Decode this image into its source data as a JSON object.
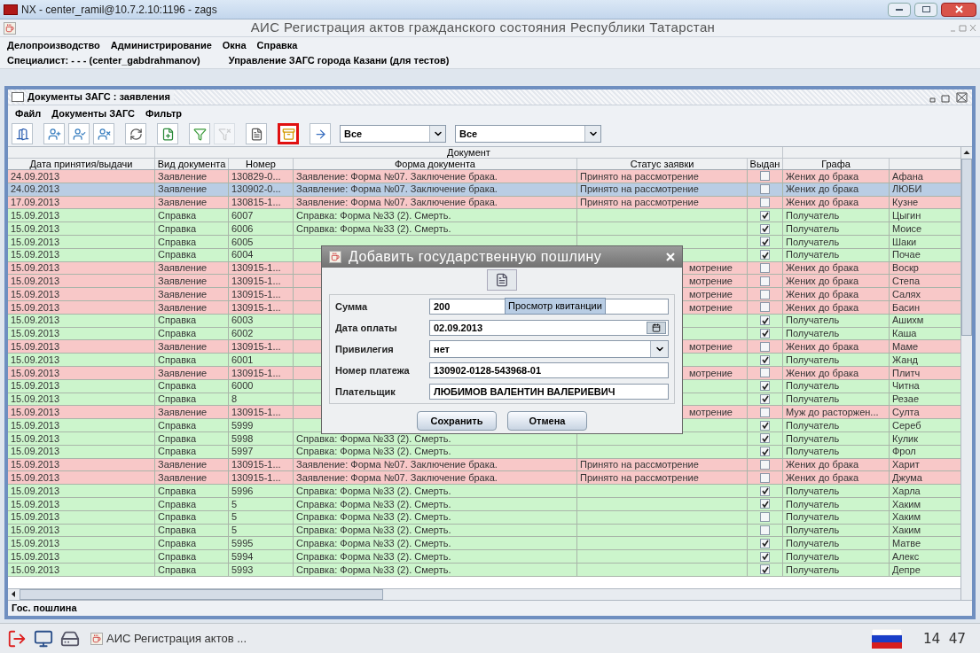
{
  "window": {
    "title": "NX - center_ramil@10.7.2.10:1196 - zags"
  },
  "app": {
    "title": "АИС Регистрация актов гражданского состояния Республики Татарстан",
    "menu": [
      "Делопроизводство",
      "Администрирование",
      "Окна",
      "Справка"
    ],
    "specialist": "Специалист: - - - (center_gabdrahmanov)",
    "office": "Управление ЗАГС города Казани (для тестов)"
  },
  "frame": {
    "title": "Документы ЗАГС : заявления",
    "menu": [
      "Файл",
      "Документы ЗАГС",
      "Фильтр"
    ],
    "toolbar": [
      {
        "kind": "exit",
        "highlighted": false,
        "disabled": false
      },
      {
        "kind": "add",
        "highlighted": false,
        "disabled": false
      },
      {
        "kind": "check",
        "highlighted": false,
        "disabled": false
      },
      {
        "kind": "remove",
        "highlighted": false,
        "disabled": false
      },
      {
        "kind": "refresh",
        "highlighted": false,
        "disabled": false
      },
      {
        "kind": "new",
        "highlighted": false,
        "disabled": false
      },
      {
        "kind": "filter",
        "highlighted": false,
        "disabled": false
      },
      {
        "kind": "unfilter",
        "highlighted": false,
        "disabled": true
      },
      {
        "kind": "document",
        "highlighted": false,
        "disabled": false
      },
      {
        "kind": "fee",
        "highlighted": true,
        "disabled": false
      },
      {
        "kind": "go",
        "highlighted": false,
        "disabled": false
      }
    ],
    "combos": [
      {
        "value": "Все"
      },
      {
        "value": "Все"
      }
    ],
    "group_header": "Документ",
    "columns": [
      "Дата принятия/выдачи",
      "Вид документа",
      "Номер",
      "Форма документа",
      "Статус заявки",
      "Выдан",
      "Графа"
    ],
    "rows": [
      {
        "date": "24.09.2013",
        "kind": "Заявление",
        "number": "130829-0...",
        "form": "Заявление: Форма №07. Заключение брака.",
        "status": "Принято на рассмотрение",
        "issued": false,
        "role": "Жених до брака",
        "name": "Афана",
        "color": "#f8c8c8",
        "selected": false
      },
      {
        "date": "24.09.2013",
        "kind": "Заявление",
        "number": "130902-0...",
        "form": "Заявление: Форма №07. Заключение брака.",
        "status": "Принято на рассмотрение",
        "issued": false,
        "role": "Жених до брака",
        "name": "ЛЮБИ",
        "selected": true
      },
      {
        "date": "17.09.2013",
        "kind": "Заявление",
        "number": "130815-1...",
        "form": "Заявление: Форма №07. Заключение брака.",
        "status": "Принято на рассмотрение",
        "issued": false,
        "role": "Жених до брака",
        "name": "Кузне",
        "color": "#f8c8c8",
        "selected": false
      },
      {
        "date": "15.09.2013",
        "kind": "Справка",
        "number": "6007",
        "form": "Справка: Форма №33 (2). Смерть.",
        "issued": true,
        "role": "Получатель",
        "name": "Цыгин",
        "color": "#ccf5cc",
        "selected": false
      },
      {
        "date": "15.09.2013",
        "kind": "Справка",
        "number": "6006",
        "form": "Справка: Форма №33 (2). Смерть.",
        "issued": true,
        "role": "Получатель",
        "name": "Моисе",
        "color": "#ccf5cc",
        "selected": false
      },
      {
        "date": "15.09.2013",
        "kind": "Справка",
        "number": "6005",
        "issued": true,
        "role": "Получатель",
        "name": "Шаки",
        "color": "#ccf5cc",
        "selected": false
      },
      {
        "date": "15.09.2013",
        "kind": "Справка",
        "number": "6004",
        "issued": true,
        "role": "Получатель",
        "name": "Почае",
        "color": "#ccf5cc",
        "selected": false
      },
      {
        "date": "15.09.2013",
        "kind": "Заявление",
        "number": "130915-1...",
        "status_tail": "мотрение",
        "issued": false,
        "role": "Жених до брака",
        "name": "Воскр",
        "color": "#f8c8c8",
        "selected": false
      },
      {
        "date": "15.09.2013",
        "kind": "Заявление",
        "number": "130915-1...",
        "status_tail": "мотрение",
        "issued": false,
        "role": "Жених до брака",
        "name": "Степа",
        "color": "#f8c8c8",
        "selected": false
      },
      {
        "date": "15.09.2013",
        "kind": "Заявление",
        "number": "130915-1...",
        "status_tail": "мотрение",
        "issued": false,
        "role": "Жених до брака",
        "name": "Салях",
        "color": "#f8c8c8",
        "selected": false
      },
      {
        "date": "15.09.2013",
        "kind": "Заявление",
        "number": "130915-1...",
        "status_tail": "мотрение",
        "issued": false,
        "role": "Жених до брака",
        "name": "Басин",
        "color": "#f8c8c8",
        "selected": false
      },
      {
        "date": "15.09.2013",
        "kind": "Справка",
        "number": "6003",
        "issued": true,
        "role": "Получатель",
        "name": "Ашихм",
        "color": "#ccf5cc",
        "selected": false
      },
      {
        "date": "15.09.2013",
        "kind": "Справка",
        "number": "6002",
        "issued": true,
        "role": "Получатель",
        "name": "Каша",
        "color": "#ccf5cc",
        "selected": false
      },
      {
        "date": "15.09.2013",
        "kind": "Заявление",
        "number": "130915-1...",
        "status_tail": "мотрение",
        "issued": false,
        "role": "Жених до брака",
        "name": "Маме",
        "color": "#f8c8c8",
        "selected": false
      },
      {
        "date": "15.09.2013",
        "kind": "Справка",
        "number": "6001",
        "issued": true,
        "role": "Получатель",
        "name": "Жанд",
        "color": "#ccf5cc",
        "selected": false
      },
      {
        "date": "15.09.2013",
        "kind": "Заявление",
        "number": "130915-1...",
        "status_tail": "мотрение",
        "issued": false,
        "role": "Жених до брака",
        "name": "Плитч",
        "color": "#f8c8c8",
        "selected": false
      },
      {
        "date": "15.09.2013",
        "kind": "Справка",
        "number": "6000",
        "issued": true,
        "role": "Получатель",
        "name": "Читна",
        "color": "#ccf5cc",
        "selected": false
      },
      {
        "date": "15.09.2013",
        "kind": "Справка",
        "number": "8",
        "issued": true,
        "role": "Получатель",
        "name": "Резае",
        "color": "#ccf5cc",
        "selected": false
      },
      {
        "date": "15.09.2013",
        "kind": "Заявление",
        "number": "130915-1...",
        "status_tail": "мотрение",
        "issued": false,
        "role": "Муж до расторжен...",
        "name": "Султа",
        "color": "#f8c8c8",
        "selected": false
      },
      {
        "date": "15.09.2013",
        "kind": "Справка",
        "number": "5999",
        "issued": true,
        "role": "Получатель",
        "name": "Сереб",
        "color": "#ccf5cc",
        "selected": false
      },
      {
        "date": "15.09.2013",
        "kind": "Справка",
        "number": "5998",
        "form": "Справка: Форма №33 (2). Смерть.",
        "issued": true,
        "role": "Получатель",
        "name": "Кулик",
        "color": "#ccf5cc",
        "selected": false
      },
      {
        "date": "15.09.2013",
        "kind": "Справка",
        "number": "5997",
        "form": "Справка: Форма №33 (2). Смерть.",
        "issued": true,
        "role": "Получатель",
        "name": "Фрол",
        "color": "#ccf5cc",
        "selected": false
      },
      {
        "date": "15.09.2013",
        "kind": "Заявление",
        "number": "130915-1...",
        "form": "Заявление: Форма №07. Заключение брака.",
        "status": "Принято на рассмотрение",
        "issued": false,
        "role": "Жених до брака",
        "name": "Харит",
        "color": "#f8c8c8",
        "selected": false
      },
      {
        "date": "15.09.2013",
        "kind": "Заявление",
        "number": "130915-1...",
        "form": "Заявление: Форма №07. Заключение брака.",
        "status": "Принято на рассмотрение",
        "issued": false,
        "role": "Жених до брака",
        "name": "Джума",
        "color": "#f8c8c8",
        "selected": false
      },
      {
        "date": "15.09.2013",
        "kind": "Справка",
        "number": "5996",
        "form": "Справка: Форма №33 (2). Смерть.",
        "issued": true,
        "role": "Получатель",
        "name": "Харла",
        "color": "#ccf5cc",
        "selected": false
      },
      {
        "date": "15.09.2013",
        "kind": "Справка",
        "number": "5",
        "form": "Справка: Форма №33 (2). Смерть.",
        "issued": true,
        "role": "Получатель",
        "name": "Хаким",
        "color": "#ccf5cc",
        "selected": false
      },
      {
        "date": "15.09.2013",
        "kind": "Справка",
        "number": "5",
        "form": "Справка: Форма №33 (2). Смерть.",
        "issued": false,
        "role": "Получатель",
        "name": "Хаким",
        "color": "#ccf5cc",
        "selected": false
      },
      {
        "date": "15.09.2013",
        "kind": "Справка",
        "number": "5",
        "form": "Справка: Форма №33 (2). Смерть.",
        "issued": false,
        "role": "Получатель",
        "name": "Хаким",
        "color": "#ccf5cc",
        "selected": false
      },
      {
        "date": "15.09.2013",
        "kind": "Справка",
        "number": "5995",
        "form": "Справка: Форма №33 (2). Смерть.",
        "issued": true,
        "role": "Получатель",
        "name": "Матве",
        "color": "#ccf5cc",
        "selected": false
      },
      {
        "date": "15.09.2013",
        "kind": "Справка",
        "number": "5994",
        "form": "Справка: Форма №33 (2). Смерть.",
        "issued": true,
        "role": "Получатель",
        "name": "Алекс",
        "color": "#ccf5cc",
        "selected": false
      },
      {
        "date": "15.09.2013",
        "kind": "Справка",
        "number": "5993",
        "form": "Справка: Форма №33 (2). Смерть.",
        "issued": true,
        "role": "Получатель",
        "name": "Депре",
        "color": "#ccf5cc",
        "selected": false
      }
    ],
    "status_bar": "Гос. пошлина"
  },
  "dialog": {
    "title": "Добавить государственную пошлину",
    "tooltip": "Просмотр квитанции",
    "fields": [
      {
        "kind": "text",
        "label": "Сумма",
        "value": "200"
      },
      {
        "kind": "date",
        "label": "Дата оплаты",
        "value": "02.09.2013"
      },
      {
        "kind": "combo",
        "label": "Привилегия",
        "value": "нет"
      },
      {
        "kind": "text",
        "label": "Номер платежа",
        "value": "130902-0128-543968-01"
      },
      {
        "kind": "text",
        "label": "Плательщик",
        "value": "ЛЮБИМОВ ВАЛЕНТИН ВАЛЕРИЕВИЧ"
      }
    ],
    "buttons": [
      "Сохранить",
      "Отмена"
    ]
  },
  "taskbar": {
    "task": "АИС Регистрация актов ...",
    "clock": "14 47"
  }
}
